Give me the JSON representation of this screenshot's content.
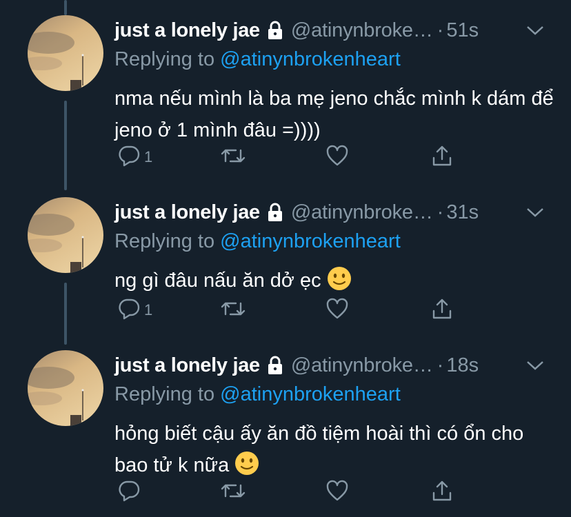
{
  "tweets": [
    {
      "name": "just a lonely jae",
      "handle": "@atinynbroke…",
      "time": "51s",
      "reply_prefix": "Replying to",
      "reply_handle": "@atinynbrokenheart",
      "text": "nma nếu mình là ba mẹ jeno chắc mình k dám để jeno ở 1 mình đâu =))))",
      "has_emoji": false,
      "reply_count": "1"
    },
    {
      "name": "just a lonely jae",
      "handle": "@atinynbroke…",
      "time": "31s",
      "reply_prefix": "Replying to",
      "reply_handle": "@atinynbrokenheart",
      "text": "ng gì đâu nấu ăn dở ẹc",
      "has_emoji": true,
      "reply_count": "1"
    },
    {
      "name": "just a lonely jae",
      "handle": "@atinynbroke…",
      "time": "18s",
      "reply_prefix": "Replying to",
      "reply_handle": "@atinynbrokenheart",
      "text": "hỏng biết cậu ấy ăn đồ tiệm hoài thì có ổn cho bao tử k nữa",
      "has_emoji": true,
      "reply_count": ""
    }
  ],
  "icons": {
    "lock": "lock-icon",
    "more": "chevron-down-icon",
    "reply": "reply-icon",
    "retweet": "retweet-icon",
    "like": "heart-icon",
    "share": "share-icon",
    "emoji": "slightly-smiling-face-emoji"
  },
  "colors": {
    "background": "#15202b",
    "name": "#ffffff",
    "secondary": "#8899a6",
    "link": "#1da1f2",
    "thread_line": "#3d5466"
  }
}
